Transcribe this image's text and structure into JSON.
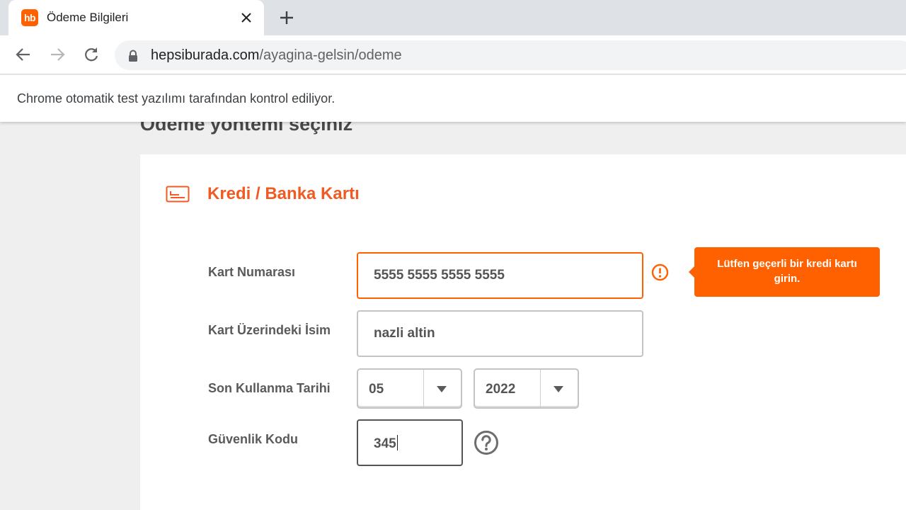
{
  "browser": {
    "tab": {
      "favicon_text": "hb",
      "title": "Ödeme Bilgileri"
    },
    "url": {
      "host": "hepsiburada.com",
      "path": "/ayagina-gelsin/odeme"
    },
    "infobar": "Chrome otomatik test yazılımı tarafından kontrol ediliyor."
  },
  "page": {
    "section_heading": "Ödeme yöntemi seçiniz",
    "panel_title": "Kredi / Banka Kartı",
    "form": {
      "card_number": {
        "label": "Kart Numarası",
        "value": "5555 5555 5555 5555",
        "error": "Lütfen geçerli bir kredi kartı girin."
      },
      "card_name": {
        "label": "Kart Üzerindeki İsim",
        "value": "nazli altin"
      },
      "expiry": {
        "label": "Son Kullanma Tarihi",
        "month": "05",
        "year": "2022"
      },
      "cvc": {
        "label": "Güvenlik Kodu",
        "value": "345"
      }
    }
  },
  "colors": {
    "brand": "#ff6000",
    "title_orange": "#f15a22",
    "label_gray": "#5a5a5a"
  }
}
